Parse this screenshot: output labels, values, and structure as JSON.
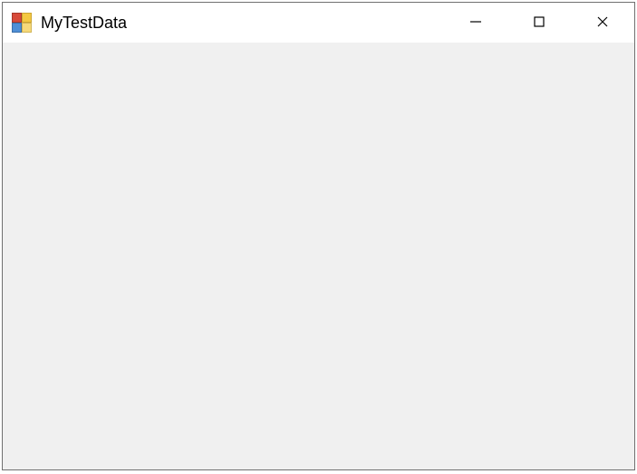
{
  "window": {
    "title": "MyTestData",
    "icon": "app-multicolor-squares-icon"
  },
  "controls": {
    "minimize": "Minimize",
    "maximize": "Maximize",
    "close": "Close"
  }
}
